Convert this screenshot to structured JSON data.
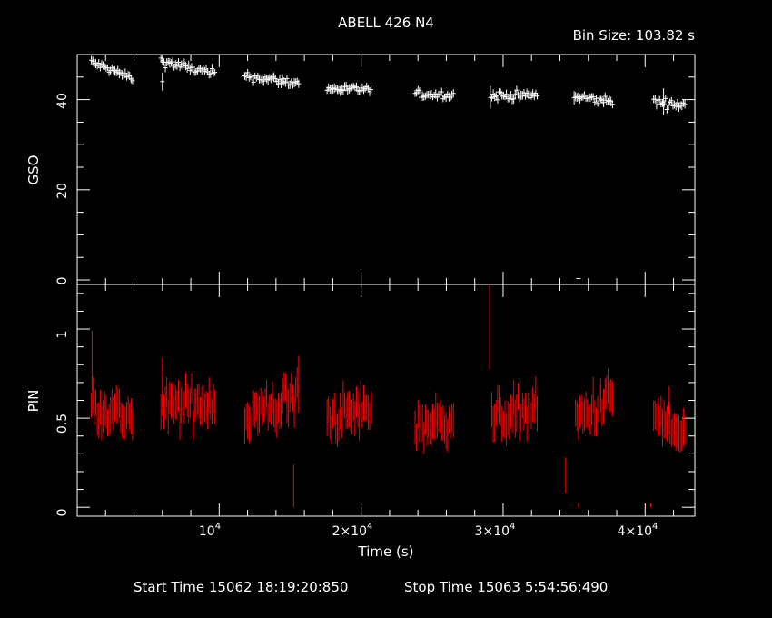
{
  "title": "ABELL 426 N4",
  "bin_size_label": "Bin Size: 103.82 s",
  "start_time_label": "Start Time 15062 18:19:20:850",
  "stop_time_label": "Stop Time 15063  5:54:56:490",
  "colors": {
    "background": "#000000",
    "frame": "#ffffff",
    "gso_series": "#ffffff",
    "pin_series": "#ff0000"
  },
  "chart_data": [
    {
      "type": "scatter",
      "panel": "top",
      "ylabel": "GSO",
      "xlabel": "",
      "xlim": [
        0,
        43500
      ],
      "ylim": [
        -1,
        50
      ],
      "x_ticks": [
        10000,
        20000,
        30000,
        40000
      ],
      "y_ticks": [
        0,
        20,
        40
      ],
      "y_tick_labels": [
        "0",
        "20",
        "40"
      ],
      "error_bars": true,
      "series": [
        {
          "segments": [
            {
              "t_start": 1000,
              "t_end": 3900,
              "y_start": 48.3,
              "y_end": 44.7,
              "noise": 0.9,
              "err": 0.9
            },
            {
              "t_start": 5900,
              "t_end": 9700,
              "y_start": 48.6,
              "y_end": 45.6,
              "noise": 1.0,
              "err": 0.9
            },
            {
              "t_start": 11800,
              "t_end": 15600,
              "y_start": 45.3,
              "y_end": 43.6,
              "noise": 1.0,
              "err": 0.9
            },
            {
              "t_start": 17600,
              "t_end": 20700,
              "y_start": 42.4,
              "y_end": 42.2,
              "noise": 0.8,
              "err": 0.9
            },
            {
              "t_start": 23800,
              "t_end": 26500,
              "y_start": 41.2,
              "y_end": 41.0,
              "noise": 0.8,
              "err": 0.9
            },
            {
              "t_start": 29200,
              "t_end": 32400,
              "y_start": 40.9,
              "y_end": 40.9,
              "noise": 1.0,
              "err": 0.9
            },
            {
              "t_start": 35100,
              "t_end": 37700,
              "y_start": 40.6,
              "y_end": 39.6,
              "noise": 1.0,
              "err": 0.9
            },
            {
              "t_start": 40600,
              "t_end": 42800,
              "y_start": 39.6,
              "y_end": 38.7,
              "noise": 1.0,
              "err": 0.9
            }
          ],
          "isolated_points": [
            {
              "x": 6000,
              "y": 44.0,
              "err": 2.0
            },
            {
              "x": 29100,
              "y": 40.5,
              "err": 2.5
            },
            {
              "x": 35000,
              "y": 40.4,
              "err": 1.5
            },
            {
              "x": 41300,
              "y": 39.5,
              "err": 3.0
            },
            {
              "x": 35300,
              "y": 0.3,
              "err": 0.1
            }
          ]
        }
      ]
    },
    {
      "type": "scatter",
      "panel": "bottom",
      "ylabel": "PIN",
      "xlabel": "Time (s)",
      "xlim": [
        0,
        43500
      ],
      "ylim": [
        -0.05,
        1.25
      ],
      "x_ticks": [
        10000,
        20000,
        30000,
        40000
      ],
      "x_tick_labels": [
        "10",
        "2×10",
        "3×10",
        "4×10"
      ],
      "x_tick_exponent": "4",
      "y_ticks": [
        0,
        0.5,
        1
      ],
      "y_tick_labels": [
        "0",
        "0.5",
        "1"
      ],
      "error_bars": true,
      "series": [
        {
          "segments": [
            {
              "t_start": 1000,
              "t_end": 3900,
              "y_start": 0.58,
              "y_end": 0.5,
              "noise": 0.09,
              "err": 0.09
            },
            {
              "t_start": 5900,
              "t_end": 9700,
              "y_start": 0.55,
              "y_end": 0.6,
              "noise": 0.09,
              "err": 0.09
            },
            {
              "t_start": 11800,
              "t_end": 15600,
              "y_start": 0.5,
              "y_end": 0.62,
              "noise": 0.11,
              "err": 0.09
            },
            {
              "t_start": 17600,
              "t_end": 20700,
              "y_start": 0.5,
              "y_end": 0.55,
              "noise": 0.09,
              "err": 0.09
            },
            {
              "t_start": 23800,
              "t_end": 26500,
              "y_start": 0.45,
              "y_end": 0.5,
              "noise": 0.08,
              "err": 0.09
            },
            {
              "t_start": 29200,
              "t_end": 32400,
              "y_start": 0.5,
              "y_end": 0.55,
              "noise": 0.09,
              "err": 0.09
            },
            {
              "t_start": 35100,
              "t_end": 37700,
              "y_start": 0.48,
              "y_end": 0.62,
              "noise": 0.09,
              "err": 0.09
            },
            {
              "t_start": 40600,
              "t_end": 42800,
              "y_start": 0.52,
              "y_end": 0.38,
              "noise": 0.09,
              "err": 0.09
            }
          ],
          "isolated_points": [
            {
              "x": 1050,
              "y": 0.82,
              "err": 0.17
            },
            {
              "x": 6000,
              "y": 0.68,
              "err": 0.16
            },
            {
              "x": 15250,
              "y": 0.12,
              "err": 0.12
            },
            {
              "x": 15600,
              "y": 0.75,
              "err": 0.1
            },
            {
              "x": 29050,
              "y": 1.02,
              "err": 0.25
            },
            {
              "x": 34400,
              "y": 0.18,
              "err": 0.1
            },
            {
              "x": 35300,
              "y": 0.01,
              "err": 0.01
            },
            {
              "x": 40400,
              "y": 0.01,
              "err": 0.01
            },
            {
              "x": 41700,
              "y": 0.6,
              "err": 0.08
            }
          ]
        }
      ]
    }
  ]
}
